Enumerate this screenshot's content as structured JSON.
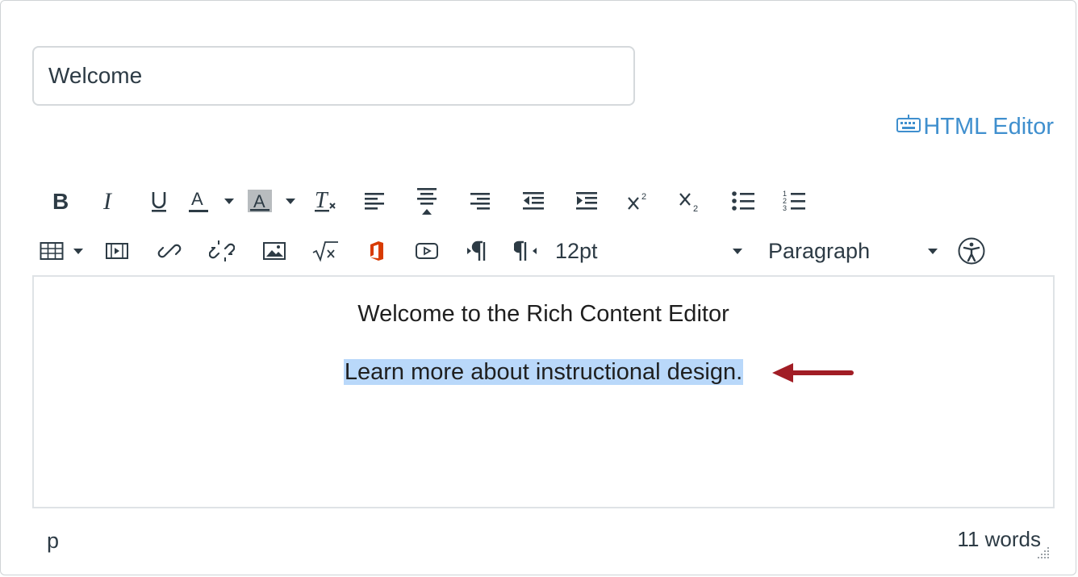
{
  "title_field": {
    "value": "Welcome"
  },
  "html_editor": {
    "label": "HTML Editor",
    "icon": "keyboard-icon"
  },
  "toolbar_row1": [
    "bold-icon",
    "italic-icon",
    "underline-icon",
    "text-color-icon",
    "text-color-dropdown",
    "background-color-icon",
    "background-color-dropdown",
    "clear-formatting-icon",
    "align-left-icon",
    "align-center-icon",
    "align-right-icon",
    "outdent-icon",
    "indent-icon",
    "superscript-icon",
    "subscript-icon",
    "bullet-list-icon",
    "numbered-list-icon"
  ],
  "toolbar_row2": [
    "table-icon",
    "media-icon",
    "link-icon",
    "unlink-icon",
    "image-icon",
    "equation-icon",
    "office-icon",
    "embed-video-icon",
    "ltr-icon",
    "rtl-icon"
  ],
  "font_size": {
    "value": "12pt"
  },
  "block_format": {
    "value": "Paragraph"
  },
  "content": {
    "line1": "Welcome to the Rich Content Editor",
    "line2": "Learn more about instructional design."
  },
  "status_bar": {
    "path": "p",
    "word_count": "11 words"
  },
  "colors": {
    "link": "#3f8fce",
    "selection": "#b9d8fa",
    "arrow": "#a11d25",
    "text": "#2d3b45"
  }
}
